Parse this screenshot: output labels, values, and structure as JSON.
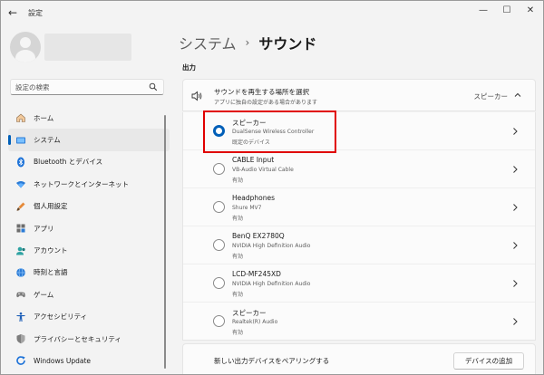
{
  "window": {
    "app_title": "設定",
    "back_glyph": "←",
    "minimize_glyph": "—",
    "maximize_glyph": "☐",
    "close_glyph": "✕"
  },
  "sidebar": {
    "search_placeholder": "設定の検索",
    "items": [
      {
        "label": "ホーム",
        "icon": "home-icon"
      },
      {
        "label": "システム",
        "icon": "system-icon",
        "active": true
      },
      {
        "label": "Bluetooth とデバイス",
        "icon": "bluetooth-icon"
      },
      {
        "label": "ネットワークとインターネット",
        "icon": "wifi-icon"
      },
      {
        "label": "個人用設定",
        "icon": "brush-icon"
      },
      {
        "label": "アプリ",
        "icon": "apps-icon"
      },
      {
        "label": "アカウント",
        "icon": "account-icon"
      },
      {
        "label": "時刻と言語",
        "icon": "globe-icon"
      },
      {
        "label": "ゲーム",
        "icon": "gamepad-icon"
      },
      {
        "label": "アクセシビリティ",
        "icon": "accessibility-icon"
      },
      {
        "label": "プライバシーとセキュリティ",
        "icon": "shield-icon"
      },
      {
        "label": "Windows Update",
        "icon": "update-icon"
      }
    ]
  },
  "main": {
    "breadcrumb_parent": "システム",
    "breadcrumb_sep": "›",
    "breadcrumb_current": "サウンド",
    "section_title": "出力",
    "output_header": {
      "title": "サウンドを再生する場所を選択",
      "subtitle": "アプリに独自の設定がある場合があります",
      "value": "スピーカー"
    },
    "devices": [
      {
        "name": "スピーカー",
        "description": "DualSense Wireless Controller",
        "status": "既定のデバイス",
        "selected": true
      },
      {
        "name": "CABLE Input",
        "description": "VB-Audio Virtual Cable",
        "status": "有効",
        "selected": false
      },
      {
        "name": "Headphones",
        "description": "Shure MV7",
        "status": "有効",
        "selected": false
      },
      {
        "name": "BenQ EX2780Q",
        "description": "NVIDIA High Definition Audio",
        "status": "有効",
        "selected": false
      },
      {
        "name": "LCD-MF245XD",
        "description": "NVIDIA High Definition Audio",
        "status": "有効",
        "selected": false
      },
      {
        "name": "スピーカー",
        "description": "Realtek(R) Audio",
        "status": "有効",
        "selected": false
      }
    ],
    "pair_text": "新しい出力デバイスをペアリングする",
    "add_device_label": "デバイスの追加"
  },
  "colors": {
    "accent": "#005fb8",
    "highlight_border": "#e00000"
  }
}
